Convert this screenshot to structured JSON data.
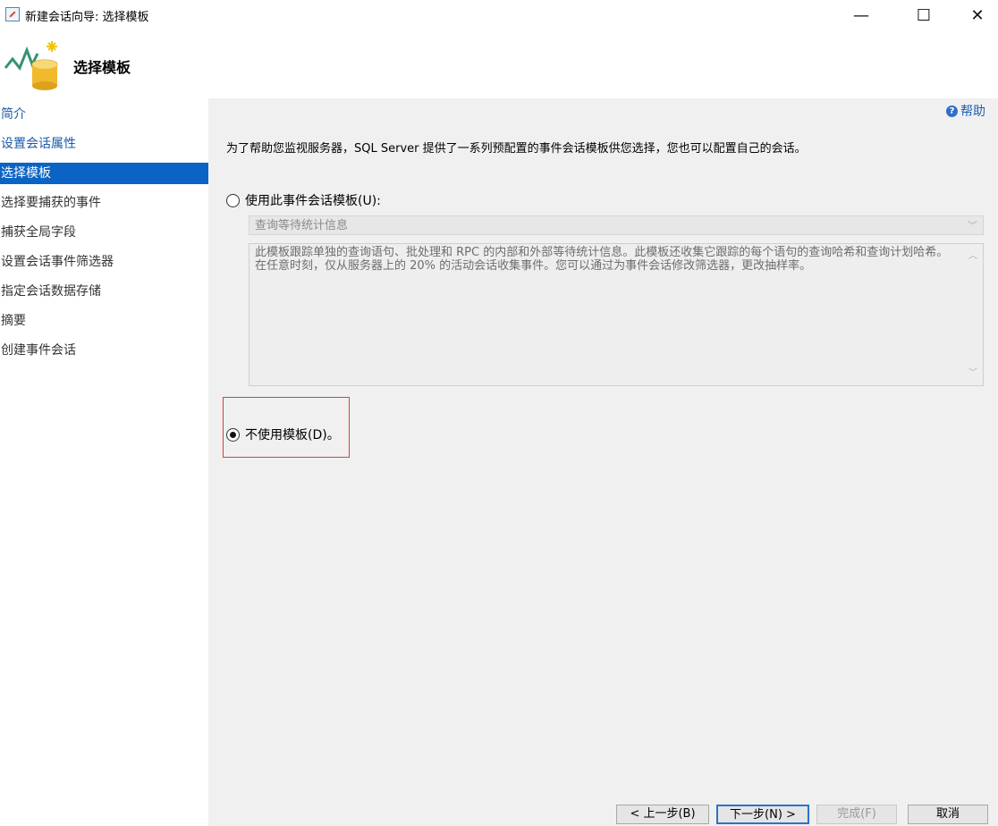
{
  "window": {
    "title": "新建会话向导: 选择模板",
    "minimize_glyph": "—",
    "maximize_glyph": "☐",
    "close_glyph": "✕"
  },
  "header": {
    "title": "选择模板",
    "icon": "wizard-chart-database-icon"
  },
  "nav": {
    "items": [
      {
        "label": "简介",
        "state": "link"
      },
      {
        "label": "设置会话属性",
        "state": "link"
      },
      {
        "label": "选择模板",
        "state": "active"
      },
      {
        "label": "选择要捕获的事件",
        "state": "normal"
      },
      {
        "label": "捕获全局字段",
        "state": "normal"
      },
      {
        "label": "设置会话事件筛选器",
        "state": "normal"
      },
      {
        "label": "指定会话数据存储",
        "state": "normal"
      },
      {
        "label": "摘要",
        "state": "normal"
      },
      {
        "label": "创建事件会话",
        "state": "normal"
      }
    ]
  },
  "content": {
    "help_label": "帮助",
    "intro": "为了帮助您监视服务器，SQL Server 提供了一系列预配置的事件会话模板供您选择，您也可以配置自己的会话。",
    "use_template_label": "使用此事件会话模板(U):",
    "template_select_value": "查询等待统计信息",
    "template_description": "此模板跟踪单独的查询语句、批处理和 RPC 的内部和外部等待统计信息。此模板还收集它跟踪的每个语句的查询哈希和查询计划哈希。在任意时刻，仅从服务器上的 20% 的活动会话收集事件。您可以通过为事件会话修改筛选器，更改抽样率。",
    "no_template_label": "不使用模板(D)。",
    "selected_option": "no_template"
  },
  "buttons": {
    "back": "< 上一步(B)",
    "next": "下一步(N) >",
    "finish": "完成(F)",
    "cancel": "取消"
  },
  "colors": {
    "nav_active": "#0b63c3",
    "link": "#1c5aa7",
    "highlight": "#e23b3b"
  }
}
